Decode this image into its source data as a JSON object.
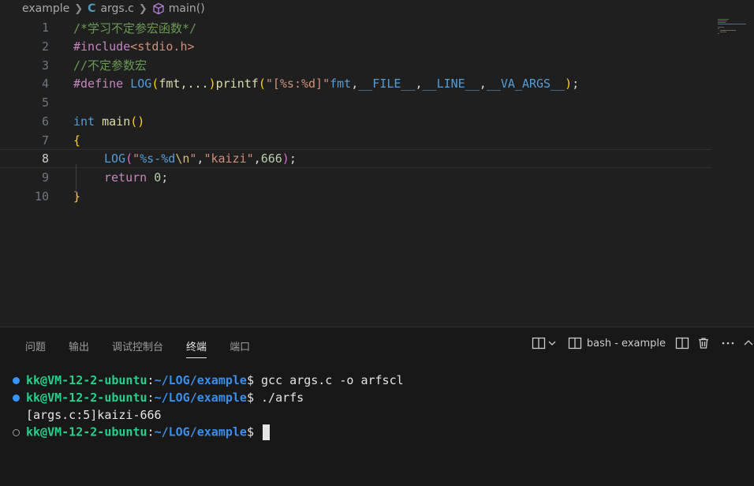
{
  "breadcrumb": {
    "folder": "example",
    "file": "args.c",
    "file_icon": "C",
    "symbol": "main()"
  },
  "editor": {
    "line_numbers": [
      "1",
      "2",
      "3",
      "4",
      "5",
      "6",
      "7",
      "8",
      "9",
      "10"
    ],
    "current_line": 8,
    "lines": {
      "l1": {
        "comment": "/*学习不定参宏函数*/"
      },
      "l2": {
        "pre": "#include",
        "inc": "<stdio.h>"
      },
      "l3": {
        "comment": "//不定参数宏"
      },
      "l4": {
        "pre": "#define",
        "macro": "LOG",
        "br_open": "(",
        "params": "fmt,...",
        "br_close": ")",
        "fn": "printf",
        "br2_open": "(",
        "str": "\"[%s:%d]\"",
        "fmt": "fmt",
        "c1": ",",
        "file": "__FILE__",
        "c2": ",",
        "line": "__LINE__",
        "c3": ",",
        "va": "__VA_ARGS__",
        "br2_close": ")",
        "semi": ";"
      },
      "l6": {
        "kw": "int",
        "fn": "main",
        "parens": "()"
      },
      "l7": {
        "brace": "{"
      },
      "l8": {
        "macro": "LOG",
        "open": "(",
        "q1": "\"",
        "s1": "%s-%d",
        "esc": "\\n",
        "q2": "\"",
        "comma": ",",
        "str2": "\"kaizi\"",
        "comma2": ",",
        "num": "666",
        "close": ")",
        "semi": ";"
      },
      "l9": {
        "kw": "return",
        "num": "0",
        "semi": ";"
      },
      "l10": {
        "brace": "}"
      }
    }
  },
  "panel": {
    "tabs": [
      "问题",
      "输出",
      "调试控制台",
      "终端",
      "端口"
    ],
    "active_tab": "终端",
    "terminal_name": "bash - example"
  },
  "terminal": {
    "lines": [
      {
        "user": "kk@VM-12-2-ubuntu",
        "colon": ":",
        "path": "~/LOG/example",
        "dollar": "$ ",
        "cmd": "gcc args.c -o arfscl"
      },
      {
        "user": "kk@VM-12-2-ubuntu",
        "colon": ":",
        "path": "~/LOG/example",
        "dollar": "$ ",
        "cmd": "./arfs"
      },
      {
        "output": "[args.c:5]kaizi-666"
      },
      {
        "user": "kk@VM-12-2-ubuntu",
        "colon": ":",
        "path": "~/LOG/example",
        "dollar": "$ ",
        "cmd": ""
      }
    ]
  },
  "colors": {
    "background": "#1f1f1f",
    "panel": "#181818",
    "prompt_user": "#23d18b",
    "prompt_path": "#3b8eea",
    "status_dot": "#3794ff"
  }
}
